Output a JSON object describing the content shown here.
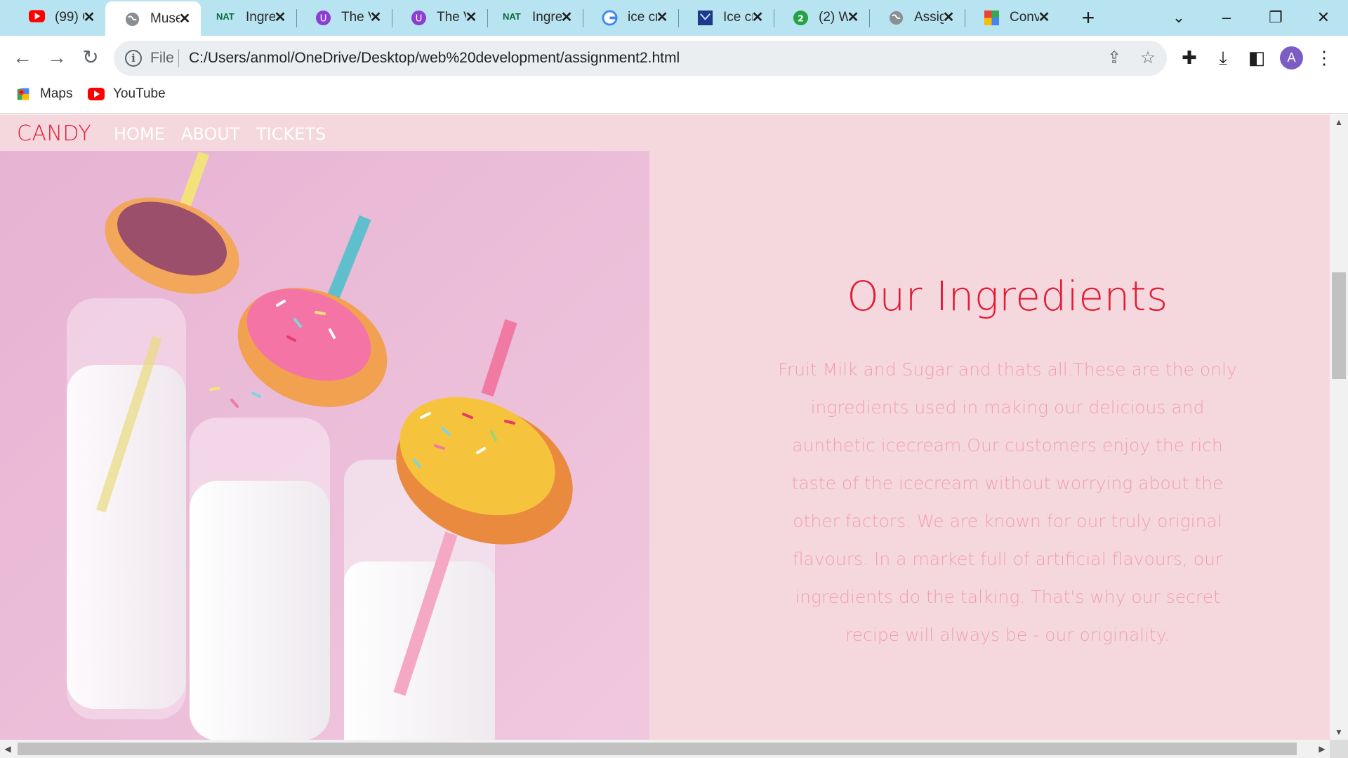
{
  "browser": {
    "tabs": [
      {
        "title": "(99) C",
        "icon": "youtube-icon"
      },
      {
        "title": "Muse",
        "icon": "globe-icon",
        "active": true
      },
      {
        "title": "Ingre",
        "icon": "nat-icon"
      },
      {
        "title": "The V",
        "icon": "u-icon"
      },
      {
        "title": "The V",
        "icon": "u-icon"
      },
      {
        "title": "Ingre",
        "icon": "nat-icon"
      },
      {
        "title": "ice cr",
        "icon": "google-icon"
      },
      {
        "title": "Ice cr",
        "icon": "shield-icon"
      },
      {
        "title": "(2) W",
        "icon": "whatsapp-icon"
      },
      {
        "title": "Assig",
        "icon": "globe-icon"
      },
      {
        "title": "Conv",
        "icon": "grid-color-icon"
      }
    ],
    "tab_close_glyph": "✕",
    "new_tab_glyph": "+",
    "nat_badge": "NAT",
    "omnibox": {
      "scheme_label": "File",
      "url": "C:/Users/anmol/OneDrive/Desktop/web%20development/assignment2.html"
    },
    "avatar_letter": "A",
    "bookmarks": [
      {
        "label": "Maps",
        "icon": "maps-icon"
      },
      {
        "label": "YouTube",
        "icon": "youtube-icon"
      }
    ]
  },
  "site": {
    "brand": "CANDY",
    "nav": [
      "HOME",
      "ABOUT",
      "TICKETS"
    ],
    "heading": "Our Ingredients",
    "paragraph": "Fruit Milk and Sugar and thats all.These are the only ingredients used in making our delicious and aunthetic icecream.Our customers enjoy the rich taste of the icecream without worrying about the other factors. We are known for our truly original flavours. In a market full of artificial flavours, our ingredients do the talking. That's why our secret recipe will always be - our originality.",
    "image_alt": "donuts-on-milk-bottles-photo"
  },
  "colors": {
    "tabstrip": "#b8e3f0",
    "page_bg": "#f5d8de",
    "accent_red": "#e31b36",
    "paragraph_pink": "#f29fb0",
    "image_bg": "#e9bcd6"
  }
}
